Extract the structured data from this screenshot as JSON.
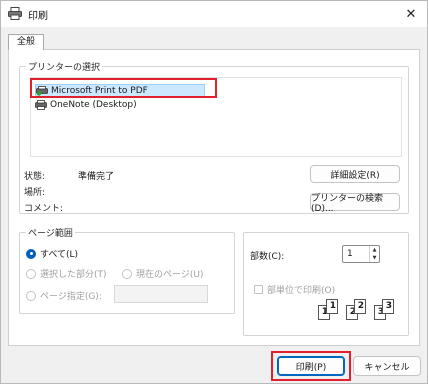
{
  "window": {
    "title": "印刷",
    "close_glyph": "✕"
  },
  "tab": {
    "label": "全般"
  },
  "printer_section": {
    "legend": "プリンターの選択",
    "printers": [
      {
        "name": "Microsoft Print to PDF",
        "selected": true
      },
      {
        "name": "OneNote (Desktop)",
        "selected": false
      }
    ],
    "status_label": "状態:",
    "status_value": "準備完了",
    "location_label": "場所:",
    "comment_label": "コメント:",
    "preferences_button": "詳細設定(R)",
    "find_printer_button": "プリンターの検索(D)..."
  },
  "page_range": {
    "legend": "ページ範囲",
    "all": "すべて(L)",
    "selection": "選択した部分(T)",
    "current_page": "現在のページ(U)",
    "pages": "ページ指定(G):"
  },
  "copies": {
    "label": "部数(C):",
    "value": "1",
    "collate_label": "部単位で印刷(O)",
    "collate_pages": [
      "1",
      "1",
      "2",
      "2",
      "3",
      "3"
    ]
  },
  "footer": {
    "print_button": "印刷(P)",
    "cancel_button": "キャンセル"
  },
  "colors": {
    "accent": "#0067c0",
    "highlight": "#e0202e",
    "selection": "#cce8ff"
  }
}
